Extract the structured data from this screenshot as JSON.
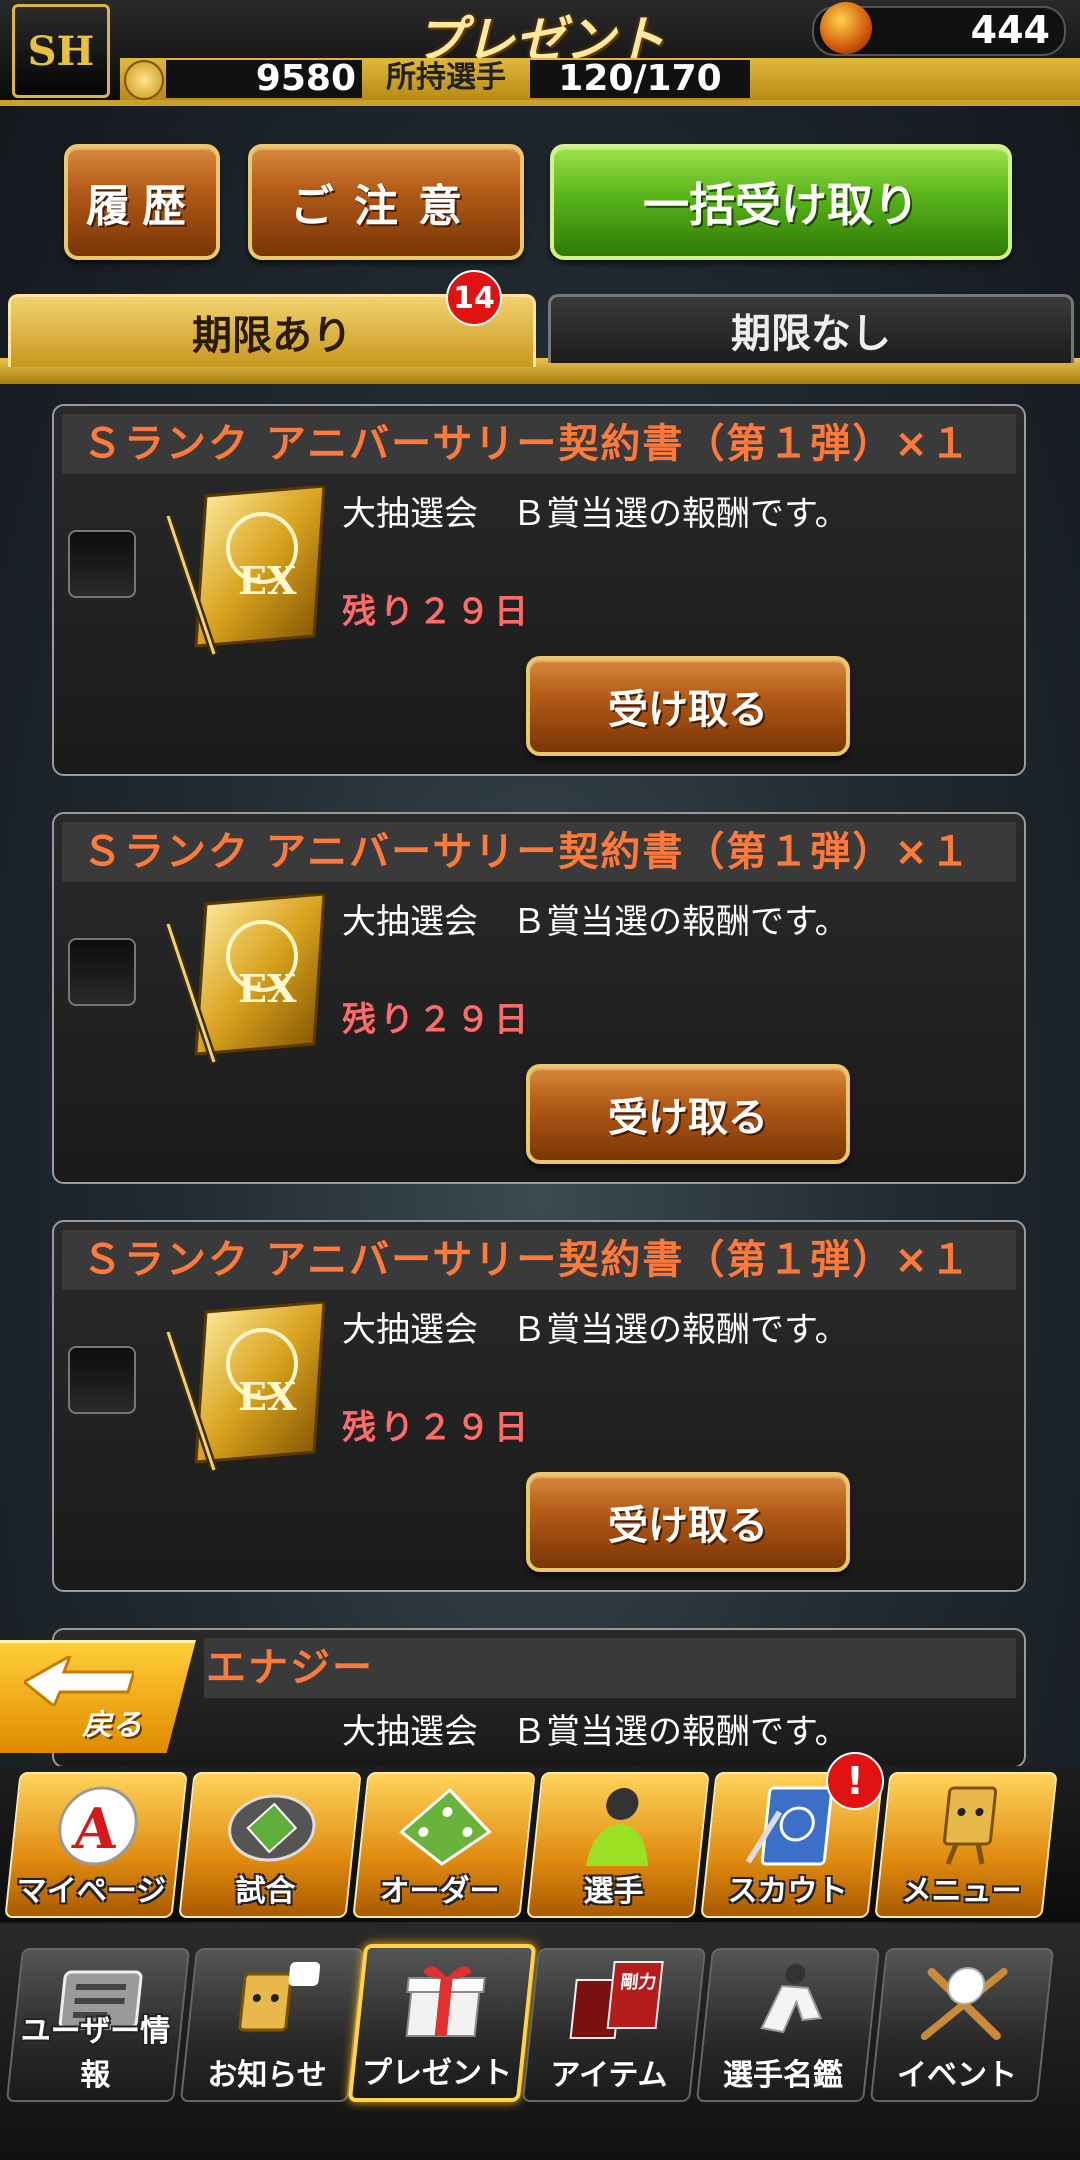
{
  "header": {
    "logo_text": "SH",
    "title": "プレゼント",
    "fuel_count": "444",
    "coin_count": "9580",
    "players_label": "所持選手",
    "players_count": "120/170"
  },
  "actions": {
    "history_label": "履歴",
    "caution_label": "ご注意",
    "bulk_receive_label": "一括受け取り"
  },
  "tabs": [
    {
      "label": "期限あり",
      "badge": "14",
      "active": true
    },
    {
      "label": "期限なし",
      "active": false
    }
  ],
  "presents": [
    {
      "title": "Ｓランク アニバーサリー契約書（第１弾）×１",
      "description": "大抽選会　Ｂ賞当選の報酬です。",
      "remaining": "残り２９日",
      "button": "受け取る",
      "icon": "ex-contract-card-icon"
    },
    {
      "title": "Ｓランク アニバーサリー契約書（第１弾）×１",
      "description": "大抽選会　Ｂ賞当選の報酬です。",
      "remaining": "残り２９日",
      "button": "受け取る",
      "icon": "ex-contract-card-icon"
    },
    {
      "title": "Ｓランク アニバーサリー契約書（第１弾）×１",
      "description": "大抽選会　Ｂ賞当選の報酬です。",
      "remaining": "残り２９日",
      "button": "受け取る",
      "icon": "ex-contract-card-icon"
    },
    {
      "title": "エナジー",
      "description": "大抽選会　Ｂ賞当選の報酬です。"
    }
  ],
  "back_label": "戻る",
  "main_nav": [
    {
      "label": "マイページ",
      "icon": "mypage-a-icon"
    },
    {
      "label": "試合",
      "icon": "stadium-icon"
    },
    {
      "label": "オーダー",
      "icon": "field-order-icon"
    },
    {
      "label": "選手",
      "icon": "player-icon"
    },
    {
      "label": "スカウト",
      "icon": "scout-book-icon",
      "badge": "!"
    },
    {
      "label": "メニュー",
      "icon": "menu-mascot-icon"
    }
  ],
  "sub_nav": [
    {
      "label": "ユーザー情報",
      "icon": "user-card-icon"
    },
    {
      "label": "お知らせ",
      "icon": "notice-mascot-icon"
    },
    {
      "label": "プレゼント",
      "icon": "gift-box-icon",
      "active": true
    },
    {
      "label": "アイテム",
      "icon": "item-book-icon",
      "book_text": "剛力"
    },
    {
      "label": "選手名鑑",
      "icon": "player-directory-icon"
    },
    {
      "label": "イベント",
      "icon": "bat-ball-icon"
    }
  ],
  "colors": {
    "accent_gold": "#d4a52a",
    "title_orange": "#ff7a3a",
    "remaining_red": "#ff6a6a",
    "badge_red": "#e01212",
    "bulk_green": "#58b41a"
  }
}
